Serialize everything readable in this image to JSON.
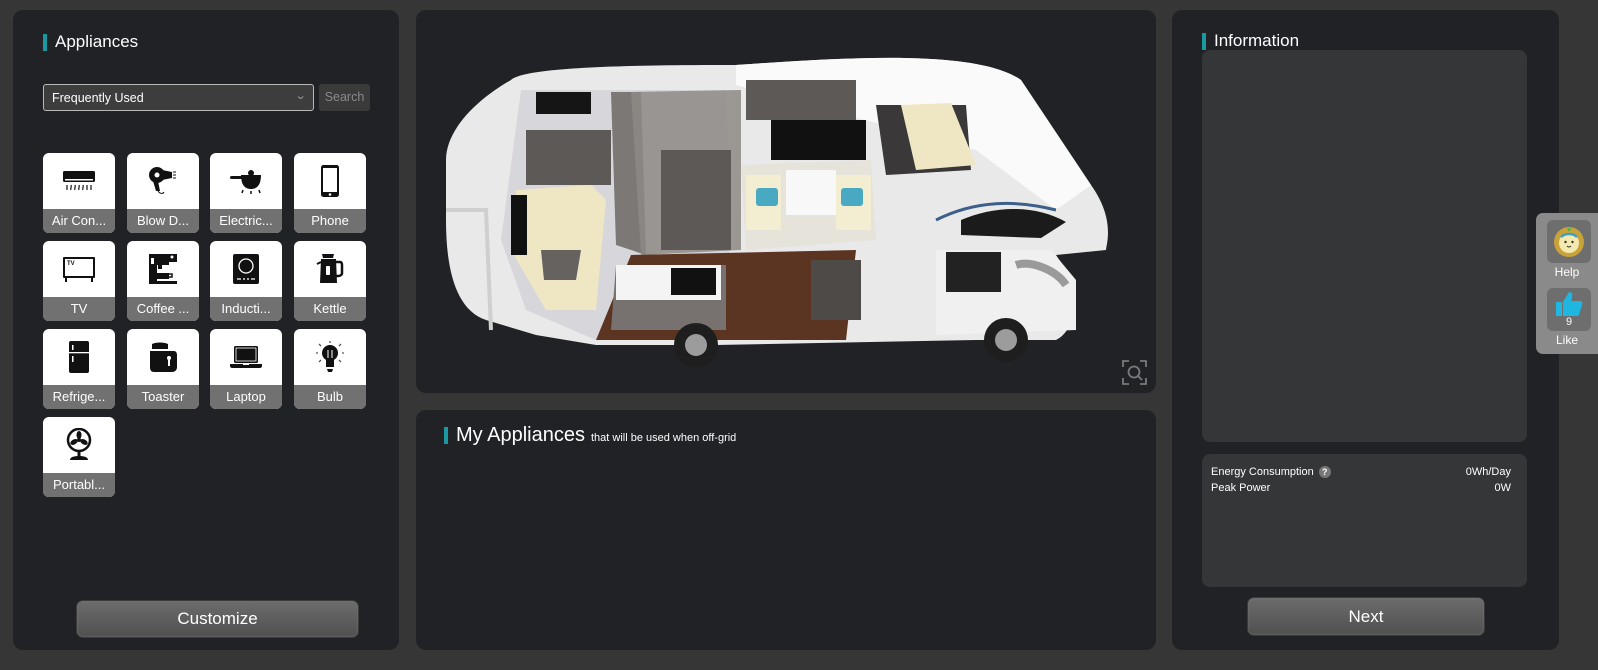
{
  "appliances_panel": {
    "title": "Appliances",
    "category_select": {
      "value": "Frequently Used"
    },
    "search_button": "Search",
    "items": [
      {
        "label": "Air Con...",
        "icon": "air-conditioner-icon"
      },
      {
        "label": "Blow D...",
        "icon": "blow-dryer-icon"
      },
      {
        "label": "Electric...",
        "icon": "electric-pot-icon"
      },
      {
        "label": "Phone",
        "icon": "phone-icon"
      },
      {
        "label": "TV",
        "icon": "tv-icon"
      },
      {
        "label": "Coffee ...",
        "icon": "coffee-maker-icon"
      },
      {
        "label": "Inducti...",
        "icon": "induction-cooker-icon"
      },
      {
        "label": "Kettle",
        "icon": "kettle-icon"
      },
      {
        "label": "Refrige...",
        "icon": "refrigerator-icon"
      },
      {
        "label": "Toaster",
        "icon": "toaster-icon"
      },
      {
        "label": "Laptop",
        "icon": "laptop-icon"
      },
      {
        "label": "Bulb",
        "icon": "bulb-icon"
      },
      {
        "label": "Portabl...",
        "icon": "fan-icon"
      }
    ],
    "customize_button": "Customize"
  },
  "viewer": {
    "image": "camper-van-cutaway-3d",
    "zoom_icon": "zoom-icon"
  },
  "my_appliances": {
    "title": "My Appliances",
    "subtitle": "that will be used when off-grid"
  },
  "information": {
    "title": "Information",
    "energy_consumption_label": "Energy Consumption",
    "energy_consumption_value": "0Wh/Day",
    "peak_power_label": "Peak Power",
    "peak_power_value": "0W",
    "help_icon": "?",
    "next_button": "Next"
  },
  "float_widget": {
    "help_label": "Help",
    "like_count": "9",
    "like_label": "Like"
  }
}
